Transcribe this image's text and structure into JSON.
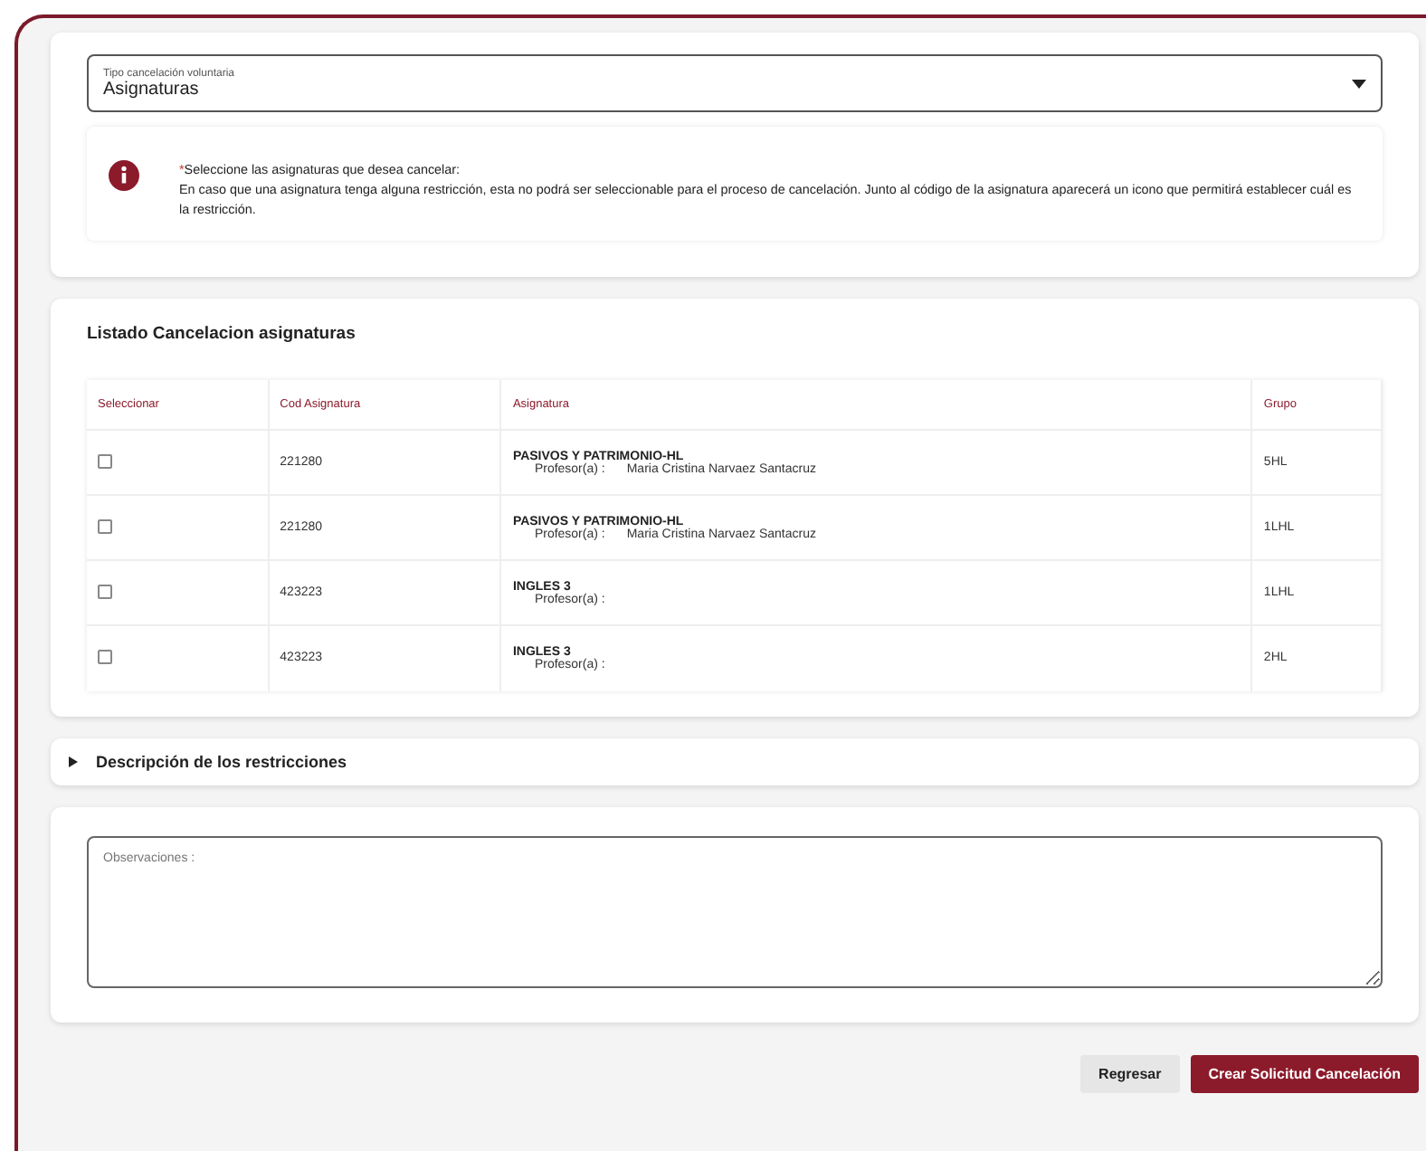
{
  "cancellation_type": {
    "label": "Tipo cancelación voluntaria",
    "value": "Asignaturas"
  },
  "notice": {
    "required_mark": "*",
    "title": "Seleccione las asignaturas que desea cancelar:",
    "body": "En caso que una asignatura tenga alguna restricción, esta no podrá ser seleccionable para el proceso de cancelación. Junto al código de la asignatura aparecerá un icono que permitirá establecer cuál es la restricción."
  },
  "listing": {
    "title": "Listado Cancelacion asignaturas",
    "columns": [
      "Seleccionar",
      "Cod Asignatura",
      "Asignatura",
      "Grupo"
    ],
    "rows": [
      {
        "checked": false,
        "code": "221280",
        "subject": "PASIVOS Y PATRIMONIO-HL",
        "teacher_label": "Profesor(a) :",
        "teacher": "Maria Cristina Narvaez Santacruz",
        "group": "5HL"
      },
      {
        "checked": false,
        "code": "221280",
        "subject": "PASIVOS Y PATRIMONIO-HL",
        "teacher_label": "Profesor(a) :",
        "teacher": "Maria Cristina Narvaez Santacruz",
        "group": "1LHL"
      },
      {
        "checked": false,
        "code": "423223",
        "subject": "INGLES 3",
        "teacher_label": "Profesor(a) :",
        "group": "1LHL"
      },
      {
        "checked": false,
        "code": "423223",
        "subject": "INGLES 3",
        "teacher_label": "Profesor(a) :",
        "group": "2HL"
      }
    ]
  },
  "restrictions": {
    "title": "Descripción de los restricciones",
    "expanded": false
  },
  "observations": {
    "placeholder": "Observaciones :"
  },
  "buttons": [
    {
      "kind": "secondary",
      "label": "Regresar"
    },
    {
      "kind": "primary",
      "label": "Crear Solicitud Cancelación"
    }
  ]
}
